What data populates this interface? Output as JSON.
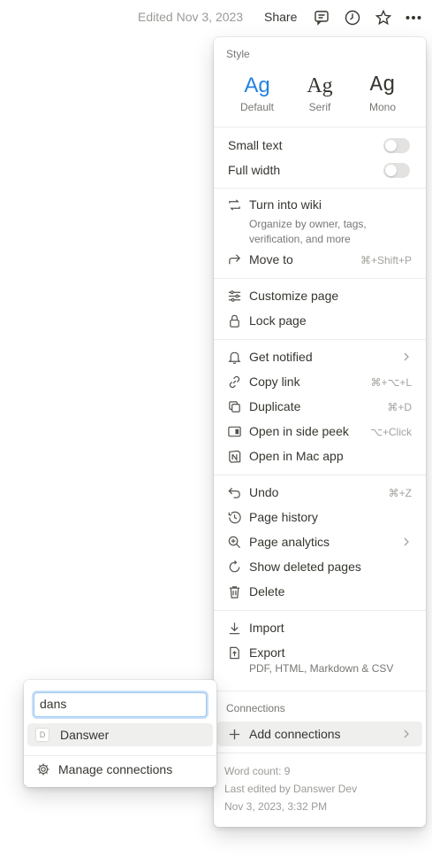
{
  "topbar": {
    "edited": "Edited Nov 3, 2023",
    "share": "Share",
    "icons": [
      "comment-icon",
      "clock-icon",
      "star-icon",
      "more-icon"
    ]
  },
  "menu": {
    "style": {
      "title": "Style",
      "options": [
        {
          "glyph": "Ag",
          "label": "Default",
          "selected": true
        },
        {
          "glyph": "Ag",
          "label": "Serif",
          "selected": false
        },
        {
          "glyph": "Ag",
          "label": "Mono",
          "selected": false
        }
      ]
    },
    "toggles": [
      {
        "label": "Small text",
        "on": false
      },
      {
        "label": "Full width",
        "on": false
      }
    ],
    "wiki": {
      "label": "Turn into wiki",
      "desc": "Organize by owner, tags, verification, and more"
    },
    "move": {
      "label": "Move to",
      "shortcut": "⌘+Shift+P"
    },
    "customize": {
      "label": "Customize page"
    },
    "lock": {
      "label": "Lock page"
    },
    "notified": {
      "label": "Get notified"
    },
    "copylink": {
      "label": "Copy link",
      "shortcut": "⌘+⌥+L"
    },
    "duplicate": {
      "label": "Duplicate",
      "shortcut": "⌘+D"
    },
    "sidepeek": {
      "label": "Open in side peek",
      "shortcut": "⌥+Click"
    },
    "macapp": {
      "label": "Open in Mac app"
    },
    "undo": {
      "label": "Undo",
      "shortcut": "⌘+Z"
    },
    "history": {
      "label": "Page history"
    },
    "analytics": {
      "label": "Page analytics"
    },
    "deleted": {
      "label": "Show deleted pages"
    },
    "delete": {
      "label": "Delete"
    },
    "import": {
      "label": "Import"
    },
    "export": {
      "label": "Export",
      "desc": "PDF, HTML, Markdown & CSV"
    },
    "connections": {
      "title": "Connections",
      "add": "Add connections"
    },
    "footer": {
      "word_count": "Word count: 9",
      "last_edited_by": "Last edited by Danswer Dev",
      "last_edited_at": "Nov 3, 2023, 3:32 PM"
    }
  },
  "popup": {
    "search_value": "dans",
    "result": {
      "badge": "D",
      "label": "Danswer"
    },
    "manage": "Manage connections"
  },
  "colors": {
    "accent": "#2383e2",
    "text": "#37352f",
    "muted": "#787774"
  }
}
